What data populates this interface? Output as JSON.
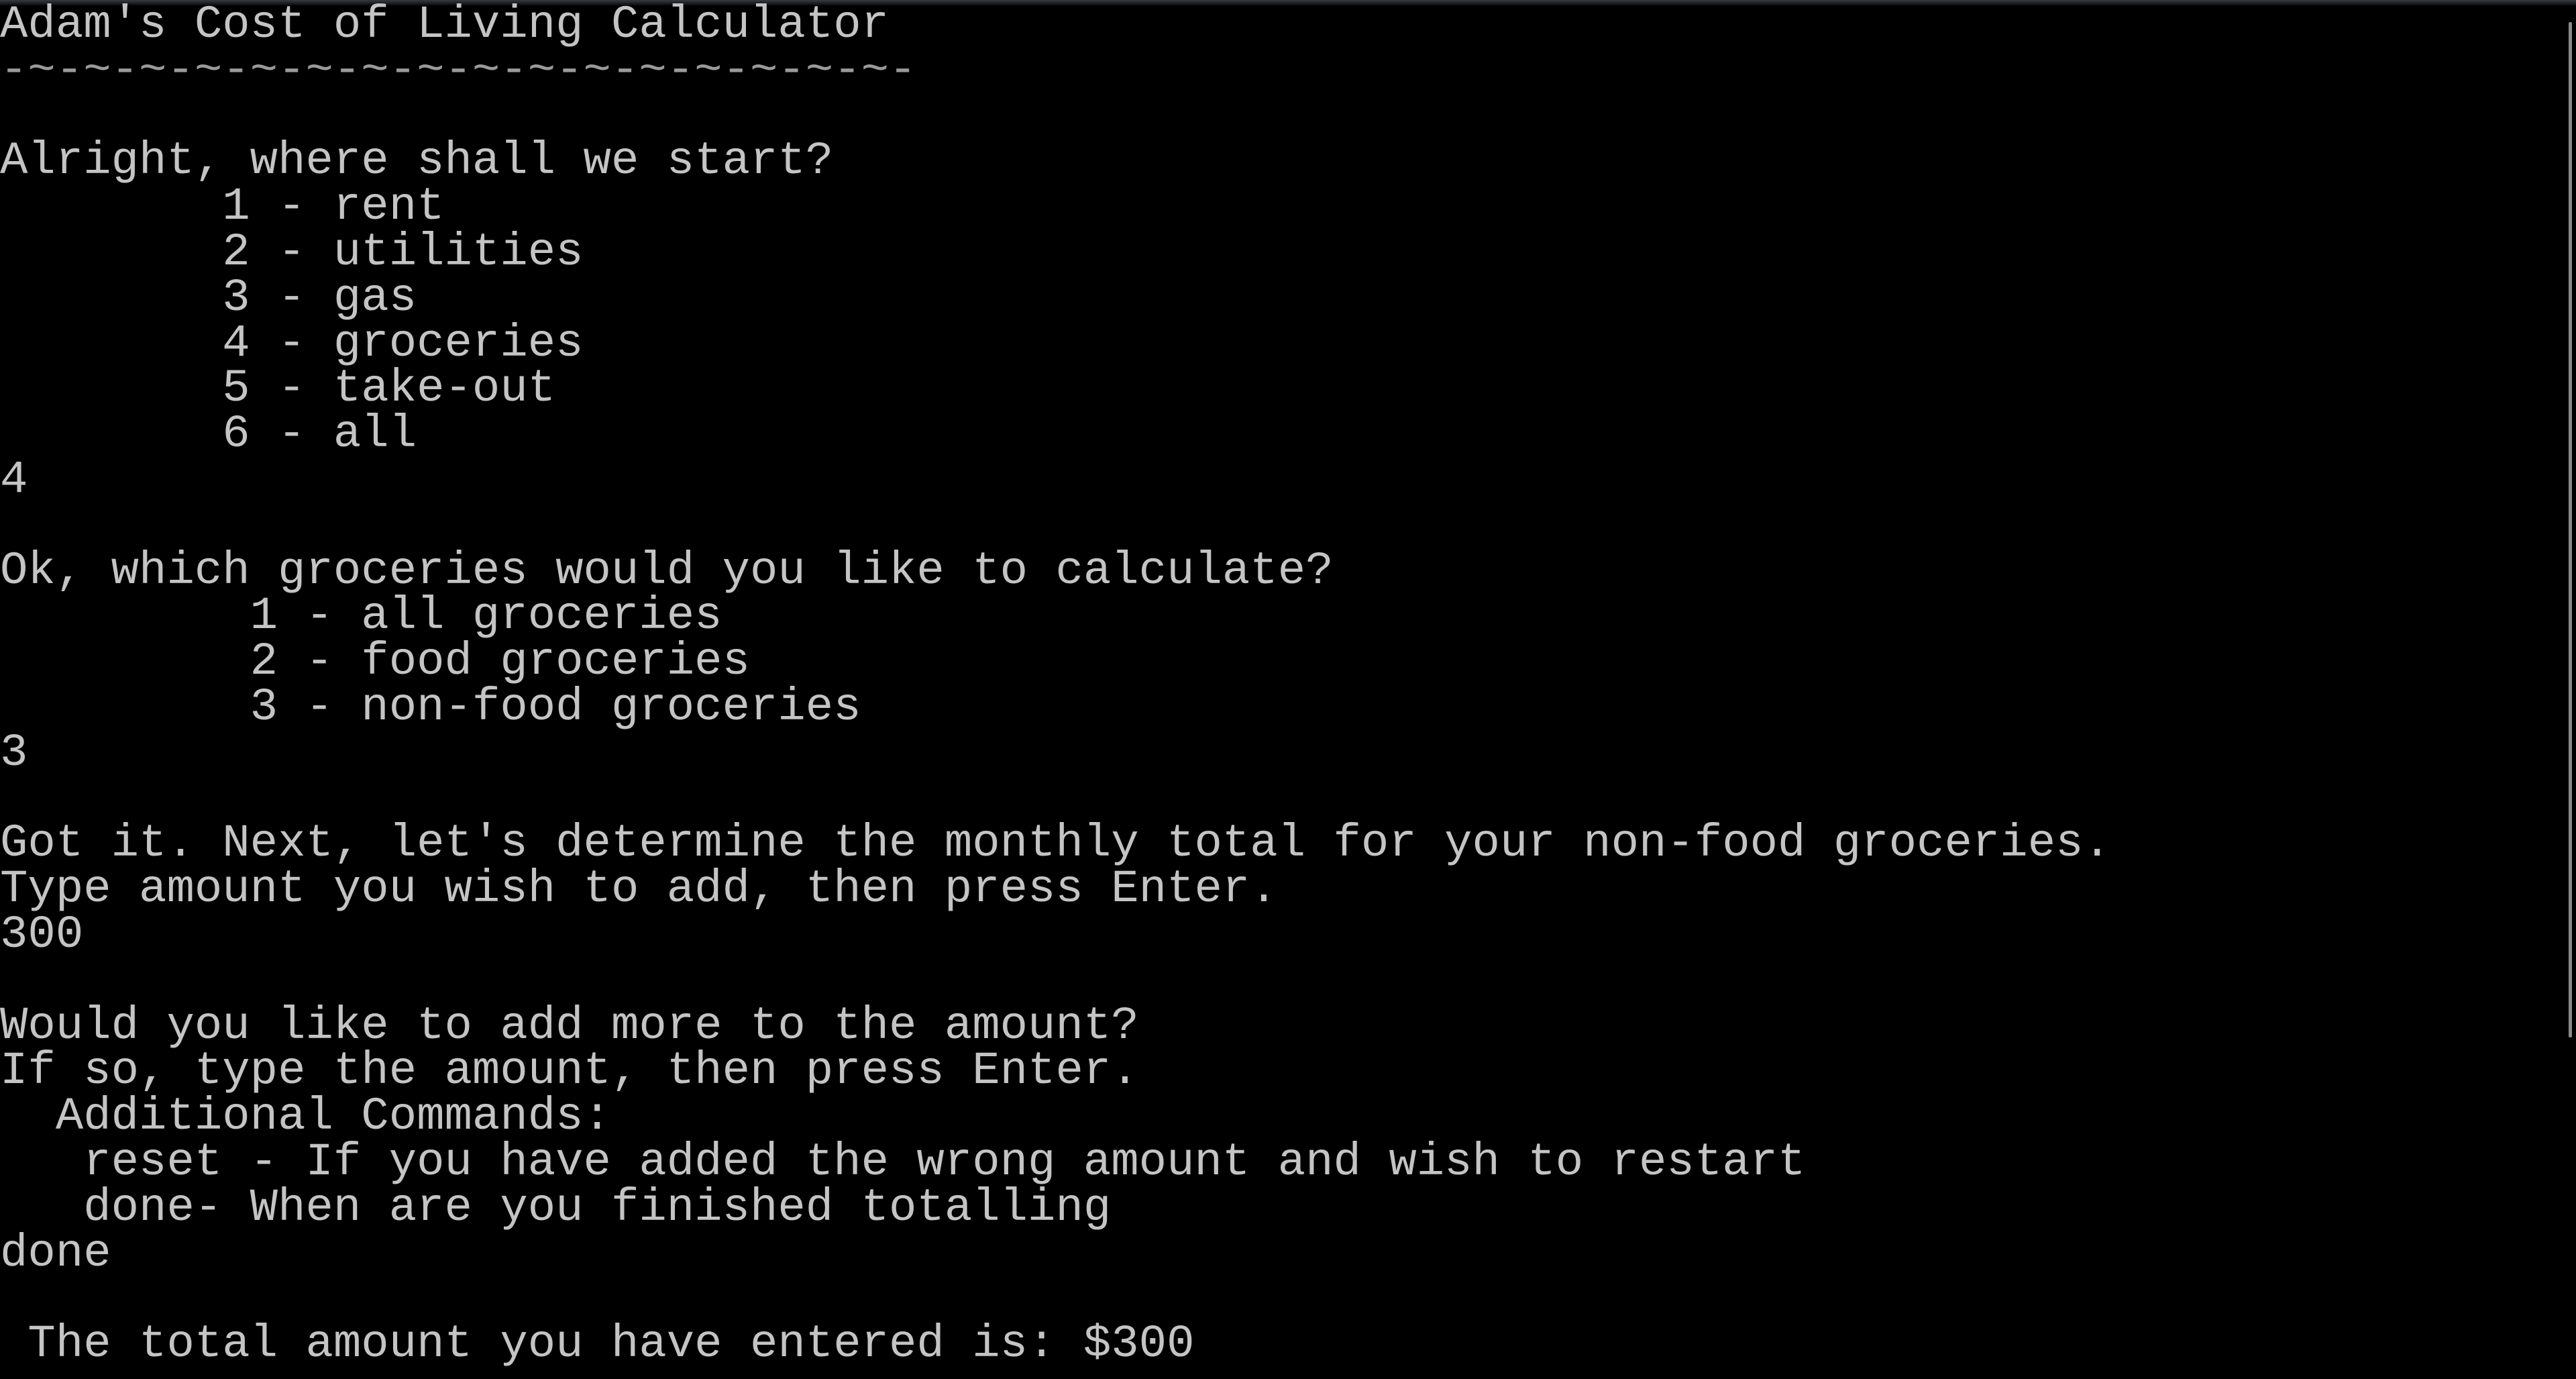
{
  "console": {
    "title": "Adam's Cost of Living Calculator",
    "divider": "-~-~-~-~-~-~-~-~-~-~-~-~-~-~-~-~-",
    "prompt_start": "Alright, where shall we start?",
    "main_options": [
      "        1 - rent",
      "        2 - utilities",
      "        3 - gas",
      "        4 - groceries",
      "        5 - take-out",
      "        6 - all"
    ],
    "input_1": "4",
    "prompt_groceries": "Ok, which groceries would you like to calculate?",
    "grocery_options": [
      "         1 - all groceries",
      "         2 - food groceries",
      "         3 - non-food groceries"
    ],
    "input_2": "3",
    "prompt_total": "Got it. Next, let's determine the monthly total for your non-food groceries.",
    "prompt_amount": "Type amount you wish to add, then press Enter.",
    "input_3": "300",
    "prompt_more": "Would you like to add more to the amount?",
    "prompt_more_2": "If so, type the amount, then press Enter.",
    "commands_header": "  Additional Commands:",
    "command_reset": "   reset - If you have added the wrong amount and wish to restart",
    "command_done": "   done- When are you finished totalling",
    "input_4": "done",
    "result": " The total amount you have entered is: $300"
  }
}
